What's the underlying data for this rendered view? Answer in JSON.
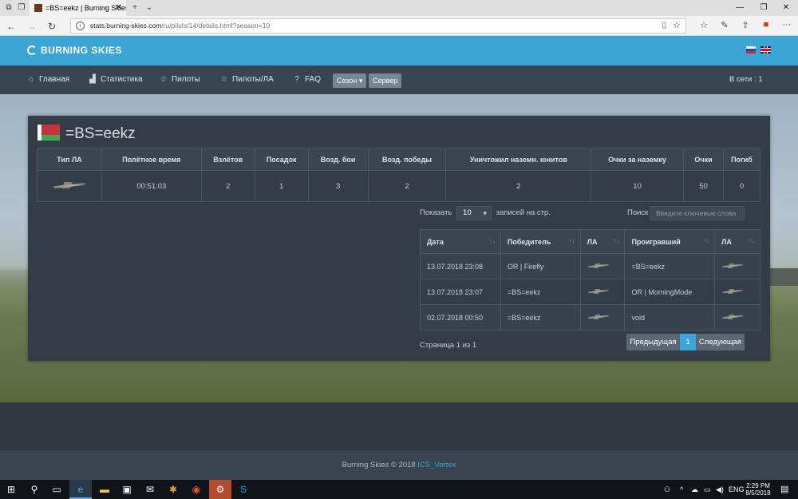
{
  "browser": {
    "tab_title": "=BS=eekz | Burning Skies",
    "url_host": "stats.burning-skies.com",
    "url_path": "/ru/pilots/14/details.html?season=10"
  },
  "site": {
    "brand": "BURNING SKIES",
    "nav": [
      "Главная",
      "Статистика",
      "Пилоты",
      "Пилоты/ЛА",
      "FAQ"
    ],
    "season_button": "Сезон",
    "server_button": "Сервер",
    "online": "В сети : 1"
  },
  "pilot": {
    "name": "=BS=eekz",
    "stats_headers": [
      "Тип ЛА",
      "Полётное время",
      "Взлётов",
      "Посадок",
      "Возд. бои",
      "Возд. победы",
      "Уничтожил наземн. юнитов",
      "Очки за наземку",
      "Очки",
      "Погиб"
    ],
    "stats_row": {
      "flight_time": "00:51:03",
      "takeoffs": "2",
      "landings": "1",
      "air_fights": "3",
      "air_victories": "2",
      "ground_units": "2",
      "ground_points": "10",
      "points": "50",
      "deaths": "0"
    }
  },
  "battles": {
    "show_prefix": "Показать",
    "page_size": "10",
    "show_suffix": "записей на стр.",
    "search_label": "Поиск",
    "search_placeholder": "Введите ключевые слова",
    "headers": [
      "Дата",
      "Победитель",
      "ЛА",
      "Проигравший",
      "ЛА"
    ],
    "rows": [
      {
        "date": "13.07.2018 23:08",
        "winner": "OR | Firefly",
        "loser": "=BS=eekz"
      },
      {
        "date": "13.07.2018 23:07",
        "winner": "=BS=eekz",
        "loser": "OR | MorningMode"
      },
      {
        "date": "02.07.2018 00:50",
        "winner": "=BS=eekz",
        "loser": "void"
      }
    ],
    "page_info": "Страница 1 из 1",
    "prev": "Предыдущая",
    "current_page": "1",
    "next": "Следующая"
  },
  "footer": {
    "text": "Burning Skies © 2018",
    "author_link": "ICS_Vortex"
  },
  "taskbar": {
    "lang": "ENG",
    "time": "2:29 PM",
    "date": "8/5/2018"
  }
}
